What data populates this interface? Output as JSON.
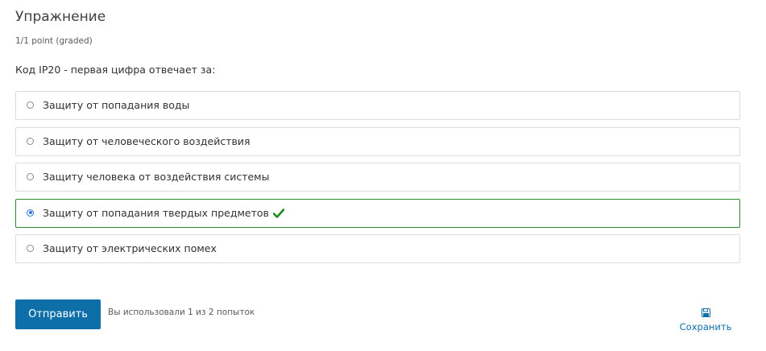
{
  "problem": {
    "title": "Упражнение",
    "points": "1/1 point (graded)",
    "question": "Код IP20 - первая цифра отвечает за:"
  },
  "options": [
    {
      "label": "Защиту от попадания воды",
      "selected": false,
      "correct": false
    },
    {
      "label": "Защиту от человеческого воздействия",
      "selected": false,
      "correct": false
    },
    {
      "label": "Защиту человека от воздействия системы",
      "selected": false,
      "correct": false
    },
    {
      "label": "Защиту от попадания твердых предметов",
      "selected": true,
      "correct": true
    },
    {
      "label": "Защиту от электрических помех",
      "selected": false,
      "correct": false
    }
  ],
  "actions": {
    "submit_label": "Отправить",
    "attempts_text": "Вы использовали 1 из 2 попыток",
    "save_label": "Сохранить"
  },
  "icons": {
    "correct": "checkmark-icon",
    "save": "floppy-disk-icon"
  },
  "colors": {
    "accent": "#0e6fa8",
    "correct_border": "#2d8a2d",
    "correct_check": "#1e8a1e",
    "radio_selected": "#2a7bd8"
  }
}
